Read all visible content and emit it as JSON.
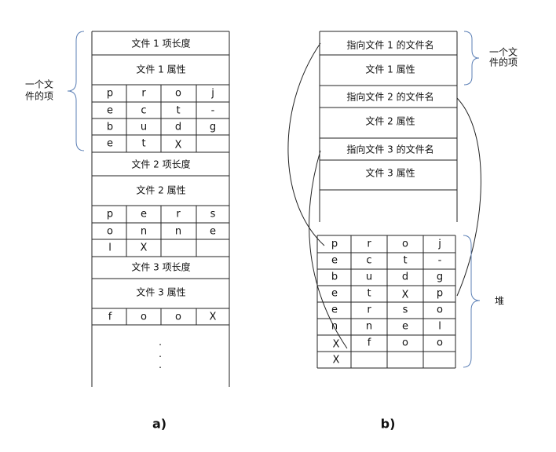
{
  "panel_a": {
    "caption": "a)",
    "brace_label_line1": "一个文",
    "brace_label_line2": "件的项",
    "file1_len": "文件 1 项长度",
    "file1_attr": "文件 1 属性",
    "file1_chars": [
      [
        "p",
        "r",
        "o",
        "j"
      ],
      [
        "e",
        "c",
        "t",
        "-"
      ],
      [
        "b",
        "u",
        "d",
        "g"
      ],
      [
        "e",
        "t",
        "X",
        ""
      ]
    ],
    "file2_len": "文件 2 项长度",
    "file2_attr": "文件 2 属性",
    "file2_chars": [
      [
        "p",
        "e",
        "r",
        "s"
      ],
      [
        "o",
        "n",
        "n",
        "e"
      ],
      [
        "l",
        "X",
        "",
        ""
      ]
    ],
    "file3_len": "文件 3 项长度",
    "file3_attr": "文件 3 属性",
    "file3_chars": [
      [
        "f",
        "o",
        "o",
        "X"
      ]
    ],
    "dots": [
      "·",
      "·",
      "·"
    ]
  },
  "panel_b": {
    "caption": "b)",
    "brace_label_line1": "一个文",
    "brace_label_line2": "件的项",
    "heap_label": "堆",
    "file1_ptr": "指向文件 1 的文件名",
    "file1_attr": "文件 1 属性",
    "file2_ptr": "指向文件 2 的文件名",
    "file2_attr": "文件 2 属性",
    "file3_ptr": "指向文件 3 的文件名",
    "file3_attr": "文件 3 属性",
    "heap_chars": [
      [
        "p",
        "r",
        "o",
        "j"
      ],
      [
        "e",
        "c",
        "t",
        "-"
      ],
      [
        "b",
        "u",
        "d",
        "g"
      ],
      [
        "e",
        "t",
        "X",
        "p"
      ],
      [
        "e",
        "r",
        "s",
        "o"
      ],
      [
        "n",
        "n",
        "e",
        "l"
      ],
      [
        "X",
        "f",
        "o",
        "o"
      ],
      [
        "X",
        "",
        "",
        ""
      ]
    ]
  }
}
